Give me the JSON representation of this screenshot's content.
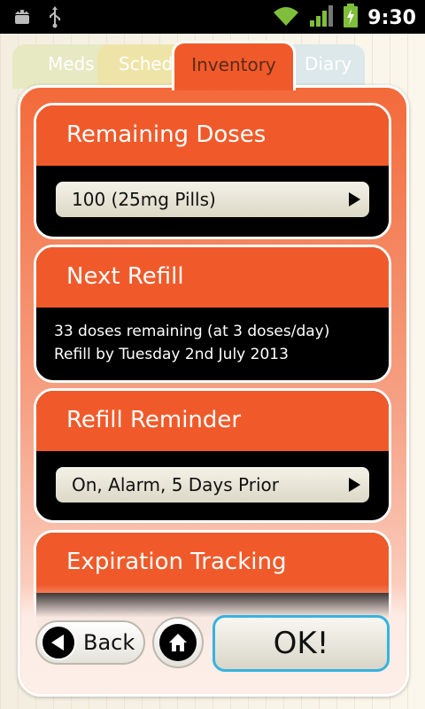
{
  "status_bar": {
    "time": "9:30",
    "icons": [
      "android-debug-icon",
      "usb-icon",
      "wifi-icon",
      "signal-icon",
      "battery-charging-icon"
    ]
  },
  "tabs": [
    {
      "label": "Meds",
      "active": false
    },
    {
      "label": "Schedule",
      "active": false
    },
    {
      "label": "Inventory",
      "active": true
    },
    {
      "label": "Diary",
      "active": false
    }
  ],
  "cards": {
    "remaining_doses": {
      "title": "Remaining Doses",
      "value": "100 (25mg Pills)"
    },
    "next_refill": {
      "title": "Next Refill",
      "line1": "33 doses remaining (at 3 doses/day)",
      "line2": "Refill by Tuesday 2nd July 2013"
    },
    "refill_reminder": {
      "title": "Refill Reminder",
      "value": "On, Alarm, 5 Days Prior"
    },
    "expiration_tracking": {
      "title": "Expiration Tracking"
    }
  },
  "buttons": {
    "back_label": "Back",
    "ok_label": "OK!"
  },
  "colors": {
    "accent": "#f05a2a",
    "ok_border": "#36b3e0",
    "card_body": "#000000"
  }
}
